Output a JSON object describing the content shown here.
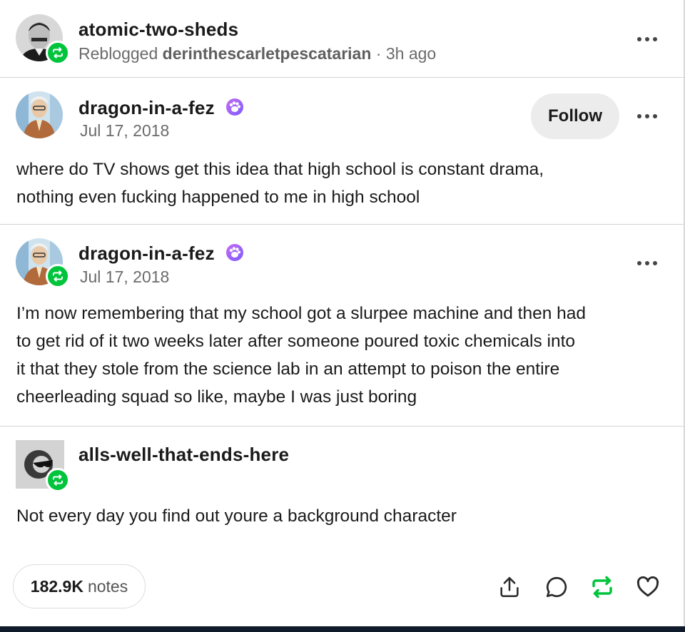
{
  "colors": {
    "reblog_green": "#00c43b",
    "text": "#1a1a1a",
    "muted": "#6b6b6b",
    "separator": "#d4d4d4"
  },
  "header": {
    "username": "atomic-two-sheds",
    "reblogged_prefix": "Reblogged",
    "reblogged_from": "derinthescarletpescatarian",
    "time": "· 3h ago"
  },
  "posts": [
    {
      "username": "dragon-in-a-fez",
      "date": "Jul 17, 2018",
      "follow_label": "Follow",
      "text_lines": [
        "where do TV shows get this idea that high school is constant drama,",
        "nothing even fucking happened to me in high school"
      ]
    },
    {
      "username": "dragon-in-a-fez",
      "date": "Jul 17, 2018",
      "text_lines": [
        "I’m now remembering that my school got a slurpee machine and then had",
        "to get rid of it two weeks later after someone poured toxic chemicals into",
        "it that they stole from the science lab in an attempt to poison the entire",
        "cheerleading squad so like, maybe I was just boring"
      ]
    },
    {
      "username": "alls-well-that-ends-here",
      "text_lines": [
        "Not every day you find out youre a background character"
      ]
    }
  ],
  "footer": {
    "notes_count": "182.9K",
    "notes_label": "notes",
    "icons": [
      "share-icon",
      "reply-icon",
      "reblog-icon",
      "like-icon"
    ]
  }
}
